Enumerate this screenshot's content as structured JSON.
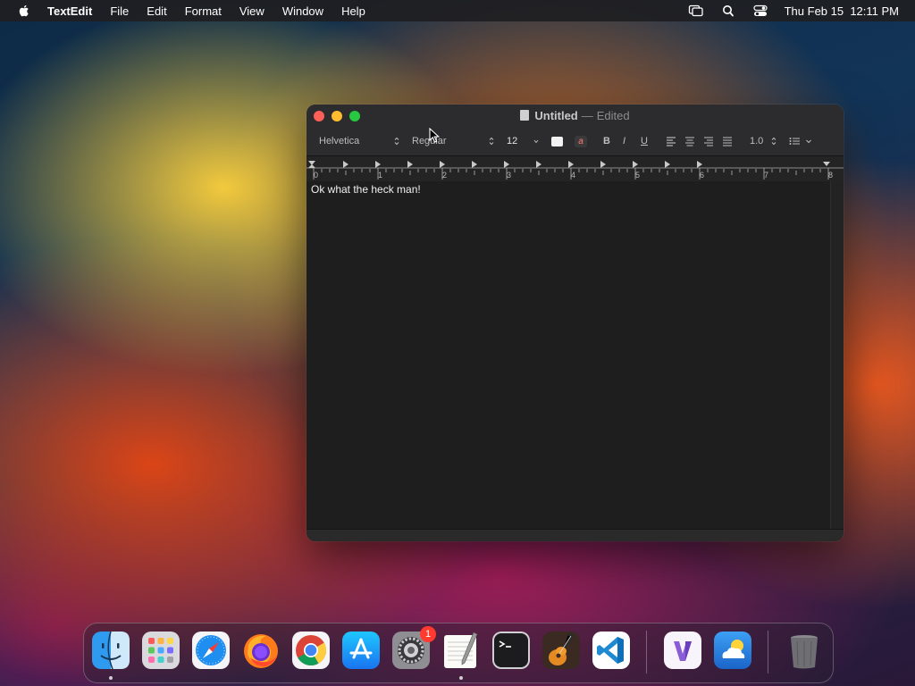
{
  "menubar": {
    "app_name": "TextEdit",
    "items": [
      "File",
      "Edit",
      "Format",
      "View",
      "Window",
      "Help"
    ],
    "status_icons": [
      "screen-mirroring-icon",
      "spotlight-search-icon",
      "control-center-icon"
    ],
    "datetime": "Thu Feb 15  12:11 PM"
  },
  "window": {
    "title": "Untitled",
    "separator": "—",
    "status": "Edited",
    "toolbar": {
      "font_family": "Helvetica",
      "font_style": "Regular",
      "font_size": "12",
      "bold_label": "B",
      "italic_label": "I",
      "underline_label": "U",
      "text_bg_label": "a",
      "line_spacing": "1.0",
      "text_color": "#f2f2f2"
    },
    "ruler_numbers": [
      "0",
      "1",
      "2",
      "3",
      "4",
      "5",
      "6",
      "7",
      "8"
    ],
    "document_text": "Ok what the heck man!"
  },
  "dock": {
    "apps": [
      {
        "name": "Finder",
        "running": true
      },
      {
        "name": "Launchpad",
        "running": false
      },
      {
        "name": "Safari",
        "running": false
      },
      {
        "name": "Firefox",
        "running": false
      },
      {
        "name": "Google Chrome",
        "running": false
      },
      {
        "name": "App Store",
        "running": false
      },
      {
        "name": "System Settings",
        "running": false,
        "badge": "1"
      },
      {
        "name": "TextEdit",
        "running": true
      },
      {
        "name": "Terminal",
        "running": false
      },
      {
        "name": "GarageBand",
        "running": false
      },
      {
        "name": "Visual Studio Code",
        "running": false
      },
      {
        "name": "Visual Studio",
        "running": false
      },
      {
        "name": "Weather",
        "running": false
      },
      {
        "name": "Trash",
        "running": false
      }
    ]
  },
  "colors": {
    "close": "#fe5f57",
    "minimize": "#febc2e",
    "maximize": "#28c840",
    "badge": "#ff3b30"
  }
}
